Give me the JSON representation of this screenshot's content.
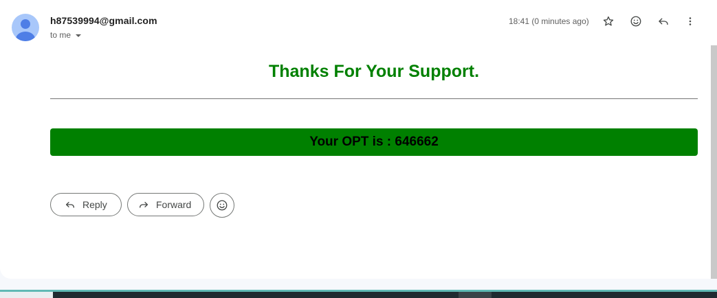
{
  "email": {
    "sender": "h87539994@gmail.com",
    "recipient_label": "to me",
    "timestamp": "18:41 (0 minutes ago)",
    "header_icons": [
      "star-icon",
      "emoji-icon",
      "reply-icon",
      "more-vert-icon"
    ]
  },
  "body": {
    "title": "Thanks For Your Support.",
    "otp_text": "Your OPT is : 646662",
    "title_color": "#008000",
    "bar_color": "#008000"
  },
  "actions": {
    "reply_label": "Reply",
    "forward_label": "Forward"
  }
}
